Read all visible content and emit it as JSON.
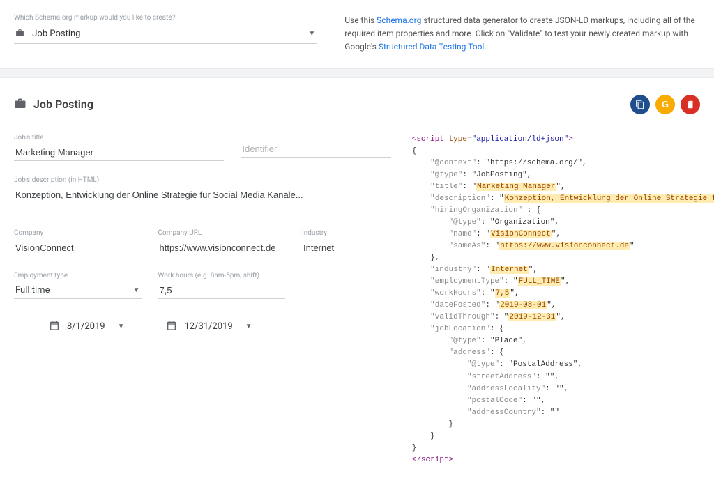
{
  "topSection": {
    "selectorLabel": "Which Schema.org markup would you like to create?",
    "selectorValue": "Job Posting",
    "helpText1": "Use this ",
    "helpLink1": "Schema.org",
    "helpText2": " structured data generator to create JSON-LD markups, including all of the required item properties and more. Click on \"Validate\" to test your newly created markup with Google's ",
    "helpLink2": "Structured Data Testing Tool",
    "helpText3": "."
  },
  "mainTitle": "Job Posting",
  "form": {
    "titleLabel": "Job's title",
    "titleValue": "Marketing Manager",
    "identifierPlaceholder": "Identifier",
    "descriptionLabel": "Job's description (in HTML)",
    "descriptionValue": "Konzeption, Entwicklung der Online Strategie für Social Media Kanäle...",
    "companyLabel": "Company",
    "companyValue": "VisionConnect",
    "companyUrlLabel": "Company URL",
    "companyUrlValue": "https://www.visionconnect.de",
    "industryLabel": "Industry",
    "industryValue": "Internet",
    "employmentTypeLabel": "Employment type",
    "employmentTypeValue": "Full time",
    "workHoursLabel": "Work hours (e.g. 8am-5pm, shift)",
    "workHoursValue": "7,5",
    "dateFrom": "8/1/2019",
    "dateTo": "12/31/2019"
  },
  "code": {
    "scriptOpen": "<script type=\"application/ld+json\">",
    "context": "\"https://schema.org/\"",
    "type": "\"JobPosting\"",
    "title": "Marketing Manager",
    "description": "Konzeption, Entwicklung der Online Strategie für Social Media",
    "orgType": "\"Organization\"",
    "orgName": "VisionConnect",
    "orgUrl": "https://www.visionconnect.de",
    "industry": "Internet",
    "employmentType": "FULL_TIME",
    "workHours": "7,5",
    "datePosted": "2019-08-01",
    "validThrough": "2019-12-31",
    "placeType": "\"Place\"",
    "postalType": "\"PostalAddress\"",
    "scriptClose": "</script>"
  }
}
